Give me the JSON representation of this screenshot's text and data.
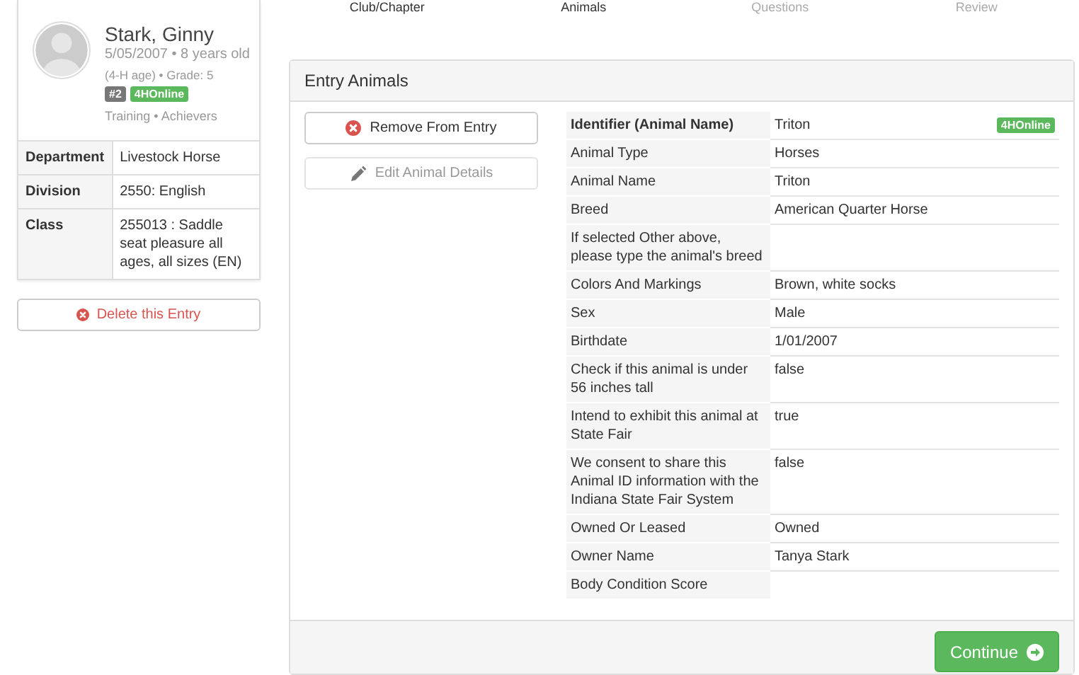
{
  "steps": [
    {
      "label": "Club/Chapter",
      "done": true
    },
    {
      "label": "Animals",
      "done": true
    },
    {
      "label": "Questions",
      "done": false
    },
    {
      "label": "Review",
      "done": false
    }
  ],
  "member": {
    "name": "Stark, Ginny",
    "birth": "5/05/2007 • 8 years old",
    "age_note": "(4-H age) • Grade: 5",
    "number_badge": "#2",
    "source_badge": "4HOnline",
    "groups": "Training • Achievers"
  },
  "entry": [
    {
      "label": "Department",
      "value": "Livestock Horse"
    },
    {
      "label": "Division",
      "value": "2550: English"
    },
    {
      "label": "Class",
      "value": "255013 : Saddle seat pleasure all ages, all sizes (EN)"
    }
  ],
  "delete_button": "Delete this Entry",
  "panel": {
    "title": "Entry Animals",
    "actions": [
      {
        "label": "Remove From Entry",
        "kind": "remove",
        "disabled": false
      },
      {
        "label": "Edit Animal Details",
        "kind": "edit",
        "disabled": true
      }
    ],
    "identifier": {
      "label": "Identifier (Animal Name)",
      "value": "Triton",
      "badge": "4HOnline"
    },
    "details": [
      {
        "label": "Animal Type",
        "value": "Horses"
      },
      {
        "label": "Animal Name",
        "value": "Triton"
      },
      {
        "label": "Breed",
        "value": "American Quarter Horse"
      },
      {
        "label": "If selected Other above, please type the animal's breed"
      },
      {
        "label": "Colors And Markings",
        "value": "Brown, white socks"
      },
      {
        "label": "Sex",
        "value": "Male"
      },
      {
        "label": "Birthdate",
        "value": "1/01/2007"
      },
      {
        "label": "Check if this animal is under 56 inches tall",
        "value": "false"
      },
      {
        "label": "Intend to exhibit this animal at State Fair",
        "value": "true"
      },
      {
        "label": "We consent to share this Animal ID information with the Indiana State Fair System",
        "value": "false"
      },
      {
        "label": "Owned Or Leased",
        "value": "Owned"
      },
      {
        "label": "Owner Name",
        "value": "Tanya Stark"
      },
      {
        "label": "Body Condition Score"
      }
    ],
    "continue_button": "Continue"
  }
}
